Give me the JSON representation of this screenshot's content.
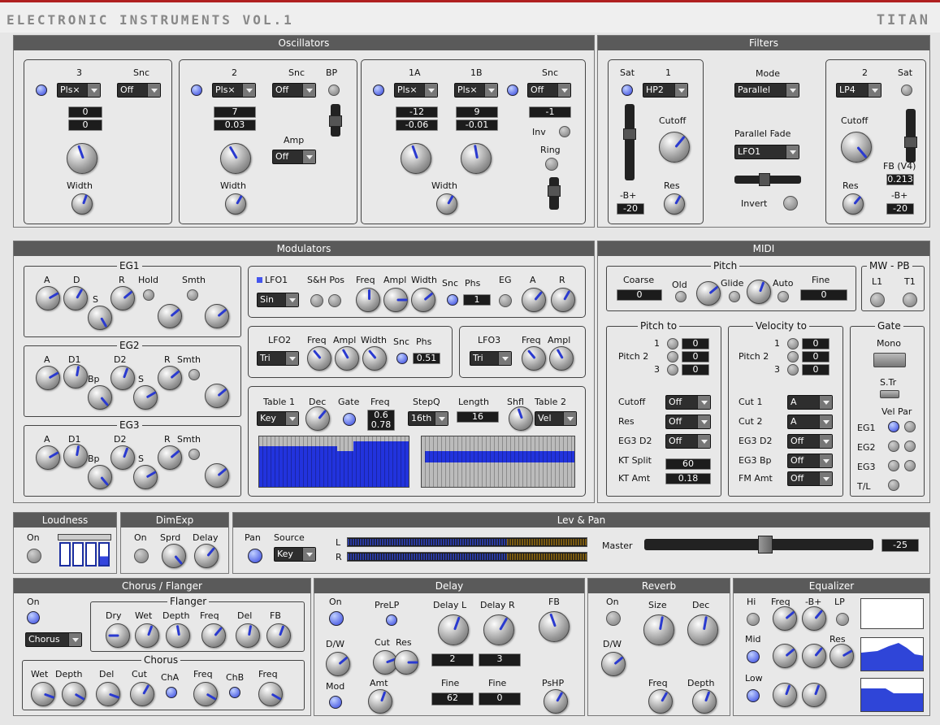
{
  "header": {
    "brand": "ELECTRONIC INSTRUMENTS VOL.1",
    "product": "TITAN"
  },
  "osc": {
    "title": "Oscillators",
    "o3": {
      "label": "3",
      "snc": "Snc",
      "wave": "Pls×",
      "snc_val": "Off",
      "v1": "0",
      "v2": "0",
      "width": "Width"
    },
    "o2": {
      "label": "2",
      "snc": "Snc",
      "bp": "BP",
      "wave": "Pls×",
      "snc_val": "Off",
      "v1": "7",
      "v2": "0.03",
      "amp": "Amp",
      "amp_val": "Off",
      "width": "Width"
    },
    "o1": {
      "l1a": "1A",
      "l1b": "1B",
      "snc": "Snc",
      "wave_a": "Pls×",
      "wave_b": "Pls×",
      "snc_val": "Off",
      "a1": "-12",
      "a2": "-0.06",
      "b1": "9",
      "b2": "-0.01",
      "s1": "-1",
      "inv": "Inv",
      "ring": "Ring",
      "width": "Width"
    }
  },
  "filters": {
    "title": "Filters",
    "f1": {
      "sat": "Sat",
      "label": "1",
      "type": "HP2",
      "cutoff": "Cutoff",
      "db": "-B+",
      "db_val": "-20",
      "res": "Res"
    },
    "mode": "Mode",
    "mode_val": "Parallel",
    "pfade": "Parallel Fade",
    "pfade_val": "LFO1",
    "invert": "Invert",
    "f2": {
      "label": "2",
      "sat": "Sat",
      "type": "LP4",
      "cutoff": "Cutoff",
      "fb": "FB (V4)",
      "fb_val": "0.213",
      "res": "Res",
      "db": "-B+",
      "db_val": "-20"
    }
  },
  "mod": {
    "title": "Modulators",
    "eg1": {
      "title": "EG1",
      "a": "A",
      "d": "D",
      "s": "S",
      "r": "R",
      "hold": "Hold",
      "smth": "Smth"
    },
    "eg2": {
      "title": "EG2",
      "a": "A",
      "d1": "D1",
      "d2": "D2",
      "bp": "Bp",
      "s": "S",
      "r": "R",
      "smth": "Smth"
    },
    "eg3": {
      "title": "EG3",
      "a": "A",
      "d1": "D1",
      "d2": "D2",
      "bp": "Bp",
      "s": "S",
      "r": "R",
      "smth": "Smth"
    },
    "lfo1": {
      "title": "LFO1",
      "shp": "S&H Pos",
      "freq": "Freq",
      "ampl": "Ampl",
      "width": "Width",
      "snc": "Snc",
      "phs": "Phs",
      "phs_val": "1",
      "eg": "EG",
      "a": "A",
      "r": "R",
      "wave": "Sin"
    },
    "lfo2": {
      "title": "LFO2",
      "freq": "Freq",
      "ampl": "Ampl",
      "width": "Width",
      "snc": "Snc",
      "phs": "Phs",
      "phs_val": "0.51",
      "wave": "Tri"
    },
    "lfo3": {
      "title": "LFO3",
      "freq": "Freq",
      "ampl": "Ampl",
      "wave": "Tri"
    },
    "seq": {
      "t1": "Table 1",
      "dec": "Dec",
      "gate": "Gate",
      "freq": "Freq",
      "freq_v1": "0.6",
      "freq_v2": "0.78",
      "stepq": "StepQ",
      "length": "Length",
      "shfl": "Shfl",
      "t2": "Table 2",
      "key": "Key",
      "stepq_val": "16th",
      "length_val": "16",
      "vel": "Vel"
    }
  },
  "midi": {
    "title": "MIDI",
    "pitch": "Pitch",
    "coarse": "Coarse",
    "coarse_val": "0",
    "old": "Old",
    "glide": "Glide",
    "auto": "Auto",
    "fine": "Fine",
    "fine_val": "0",
    "mwpb": "MW - PB",
    "l1": "L1",
    "t1": "T1",
    "pto": {
      "title": "Pitch to",
      "r1": "1",
      "pitch2": "Pitch 2",
      "r3": "3",
      "v1": "0",
      "v2": "0",
      "v3": "0",
      "cutoff": "Cutoff",
      "cutoff_val": "Off",
      "res": "Res",
      "res_val": "Off",
      "eg3d2": "EG3 D2",
      "eg3d2_val": "Off",
      "ktsplit": "KT Split",
      "ktsplit_val": "60",
      "ktamt": "KT Amt",
      "ktamt_val": "0.18"
    },
    "vto": {
      "title": "Velocity to",
      "r1": "1",
      "pitch2": "Pitch 2",
      "r3": "3",
      "v1": "0",
      "v2": "0",
      "v3": "0",
      "cut1": "Cut 1",
      "cut1_val": "A",
      "cut2": "Cut 2",
      "cut2_val": "A",
      "eg3d2": "EG3 D2",
      "eg3d2_val": "Off",
      "eg3bp": "EG3 Bp",
      "eg3bp_val": "Off",
      "fmamt": "FM Amt",
      "fmamt_val": "Off"
    },
    "gate": {
      "title": "Gate",
      "mono": "Mono",
      "str": "S.Tr",
      "velpar": "Vel Par",
      "eg1": "EG1",
      "eg2": "EG2",
      "eg3": "EG3",
      "tl": "T/L"
    }
  },
  "loud": {
    "title": "Loudness",
    "on": "On"
  },
  "dim": {
    "title": "DimExp",
    "on": "On",
    "sprd": "Sprd",
    "delay": "Delay"
  },
  "lev": {
    "title": "Lev & Pan",
    "pan": "Pan",
    "source": "Source",
    "src_val": "Key",
    "l": "L",
    "r": "R",
    "master": "Master",
    "master_val": "-25"
  },
  "chorus": {
    "title": "Chorus / Flanger",
    "on": "On",
    "mode": "Chorus",
    "flanger": "Flanger",
    "dry": "Dry",
    "wet": "Wet",
    "depth": "Depth",
    "freq": "Freq",
    "del": "Del",
    "fb": "FB",
    "chorus": "Chorus",
    "cwet": "Wet",
    "cdepth": "Depth",
    "cdel": "Del",
    "cut": "Cut",
    "cha": "ChA",
    "cfreq": "Freq",
    "chb": "ChB",
    "cfreq2": "Freq"
  },
  "delay": {
    "title": "Delay",
    "on": "On",
    "prelp": "PreLP",
    "dl": "Delay L",
    "dr": "Delay R",
    "fb": "FB",
    "dw": "D/W",
    "cut": "Cut",
    "res": "Res",
    "dl_val": "2",
    "dr_val": "3",
    "mod": "Mod",
    "amt": "Amt",
    "finel": "Fine",
    "finer": "Fine",
    "finel_val": "62",
    "finer_val": "0",
    "pshp": "PsHP"
  },
  "reverb": {
    "title": "Reverb",
    "on": "On",
    "size": "Size",
    "dec": "Dec",
    "dw": "D/W",
    "freq": "Freq",
    "depth": "Depth"
  },
  "eq": {
    "title": "Equalizer",
    "hi": "Hi",
    "freq": "Freq",
    "db": "-B+",
    "lp": "LP",
    "mid": "Mid",
    "res": "Res",
    "low": "Low"
  },
  "colors": {
    "accent": "#3344dd",
    "header": "#5a5a5a",
    "stripe": "#b02020"
  }
}
